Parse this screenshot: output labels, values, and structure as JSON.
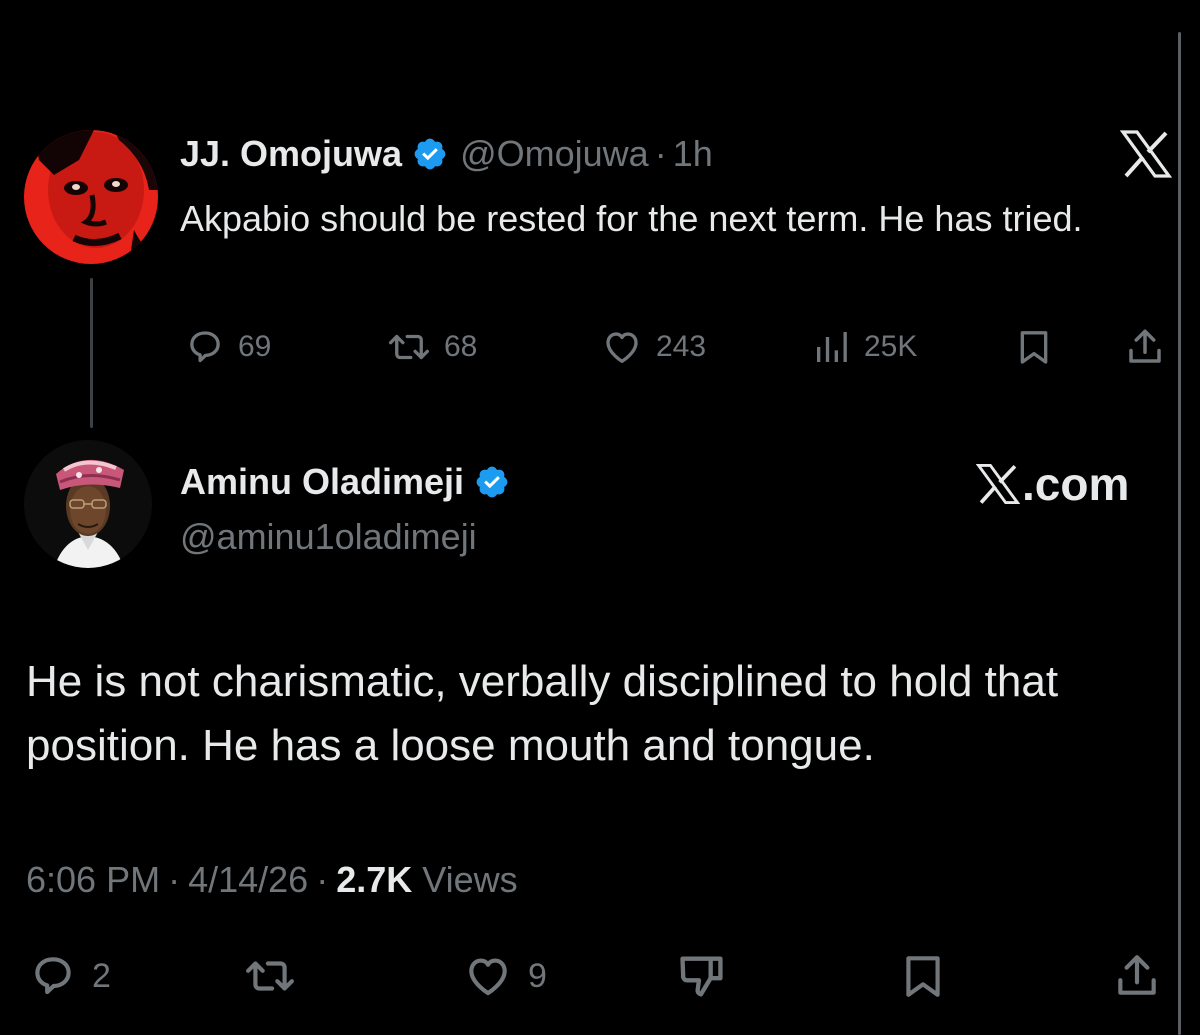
{
  "quoted_tweet": {
    "author_name": "JJ. Omojuwa",
    "handle": "@Omojuwa",
    "separator": "·",
    "time": "1h",
    "text": "Akpabio should be rested for the next term. He has tried.",
    "avatar_icon": "avatar-red-portrait-icon",
    "stats": {
      "replies": "69",
      "reposts": "68",
      "likes": "243",
      "views": "25K"
    }
  },
  "main_tweet": {
    "author_name": "Aminu Oladimeji",
    "handle": "@aminu1oladimeji",
    "brand_text": ".com",
    "text": "He is not charismatic, verbally disciplined to hold that position. He has a loose mouth and tongue.",
    "time": "6:06 PM",
    "date": "4/14/26",
    "separator": "·",
    "views_count": "2.7K",
    "views_label": "Views",
    "stats": {
      "replies": "2",
      "likes": "9"
    }
  },
  "colors": {
    "background": "#000000",
    "primary_text": "#e7e9ea",
    "secondary_text": "#71767b",
    "verified_badge": "#1d9bf0"
  }
}
